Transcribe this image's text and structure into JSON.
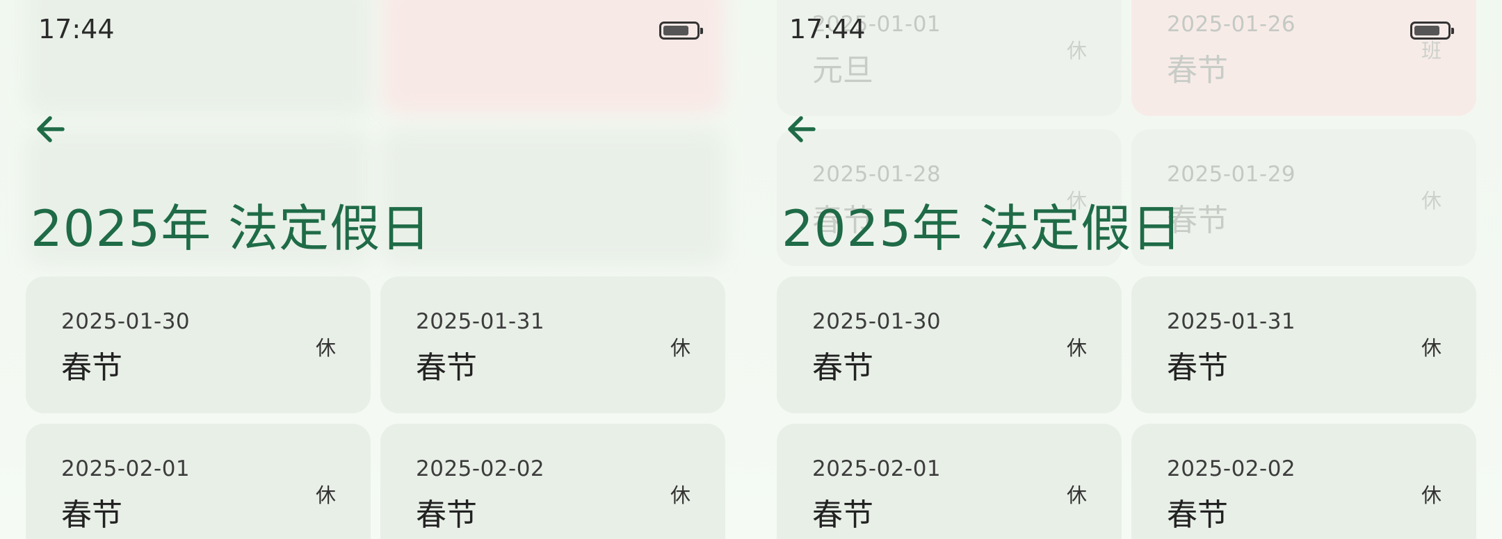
{
  "status_bar": {
    "time": "17:44",
    "battery_level": 0.8
  },
  "header": {
    "title": "2025年 法定假日",
    "back_icon": "arrow-left-icon"
  },
  "colors": {
    "accent": "#1f6b47",
    "card": "#e8efe7",
    "card_highlight": "#f9e7e5"
  },
  "left_screen": {
    "rows": [
      {
        "cards": [
          {
            "date": "",
            "name": "",
            "tag": ""
          },
          {
            "date": "",
            "name": "",
            "tag": "",
            "highlight": true
          }
        ]
      },
      {
        "cards": [
          {
            "date": "",
            "name": "",
            "tag": ""
          },
          {
            "date": "",
            "name": "",
            "tag": ""
          }
        ]
      },
      {
        "cards": [
          {
            "date": "2025-01-30",
            "name": "春节",
            "tag": "休"
          },
          {
            "date": "2025-01-31",
            "name": "春节",
            "tag": "休"
          }
        ]
      },
      {
        "cards": [
          {
            "date": "2025-02-01",
            "name": "春节",
            "tag": "休"
          },
          {
            "date": "2025-02-02",
            "name": "春节",
            "tag": "休"
          }
        ]
      }
    ]
  },
  "right_screen": {
    "rows": [
      {
        "cards": [
          {
            "date": "2025-01-01",
            "name": "元旦",
            "tag": "休"
          },
          {
            "date": "2025-01-26",
            "name": "春节",
            "tag": "班",
            "highlight": true
          }
        ]
      },
      {
        "cards": [
          {
            "date": "2025-01-28",
            "name": "春节",
            "tag": "休"
          },
          {
            "date": "2025-01-29",
            "name": "春节",
            "tag": "休"
          }
        ]
      },
      {
        "cards": [
          {
            "date": "2025-01-30",
            "name": "春节",
            "tag": "休"
          },
          {
            "date": "2025-01-31",
            "name": "春节",
            "tag": "休"
          }
        ]
      },
      {
        "cards": [
          {
            "date": "2025-02-01",
            "name": "春节",
            "tag": "休"
          },
          {
            "date": "2025-02-02",
            "name": "春节",
            "tag": "休"
          }
        ]
      }
    ]
  }
}
